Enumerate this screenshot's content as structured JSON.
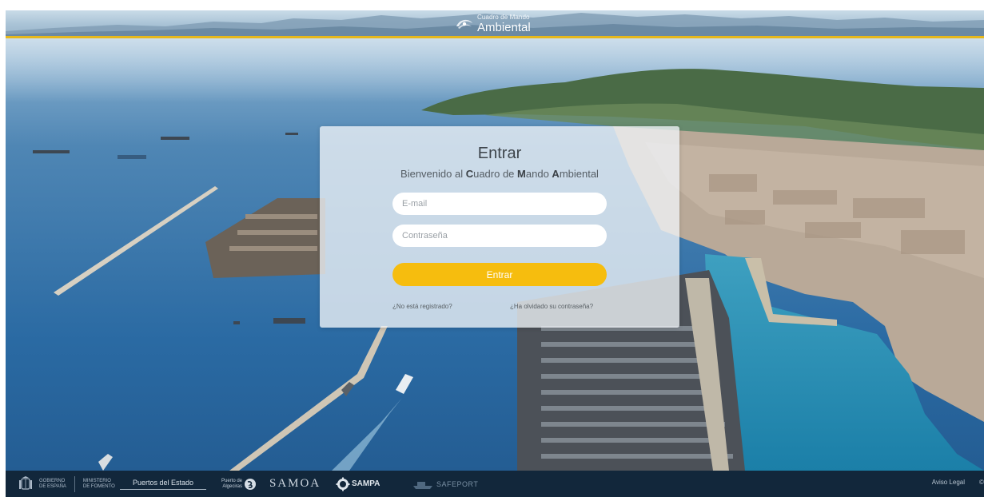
{
  "header": {
    "brand_top": "Cuadro de Mando",
    "brand_bottom": "Ambiental",
    "accent_color": "#e6b81c"
  },
  "login": {
    "title": "Entrar",
    "subtitle_prefix": "Bienvenido al ",
    "subtitle_c_bold": "C",
    "subtitle_c_rest": "uadro de ",
    "subtitle_m_bold": "M",
    "subtitle_m_rest": "ando ",
    "subtitle_a_bold": "A",
    "subtitle_a_rest": "mbiental",
    "email_placeholder": "E-mail",
    "email_value": "",
    "password_placeholder": "Contraseña",
    "password_value": "",
    "submit_label": "Entrar",
    "submit_color": "#f6bd0e",
    "register_link": "¿No está registrado?",
    "forgot_link": "¿Ha olvidado su contraseña?"
  },
  "footer": {
    "gobierno_line1": "GOBIERNO",
    "gobierno_line2": "DE ESPAÑA",
    "ministerio_line1": "MINISTERIO",
    "ministerio_line2": "DE FOMENTO",
    "puertos": "Puertos del Estado",
    "algeciras_line1": "Puerto de",
    "algeciras_line2": "Algeciras",
    "samoa": "SAMOA",
    "sampa": "SAMPA",
    "safeport": "SAFEPORT",
    "aviso_legal": "Aviso Legal",
    "copyright": "©",
    "background_color": "#12273b"
  },
  "icons": {
    "brand_logo": "swirl-logo-icon",
    "crest": "spain-crest-icon",
    "algeciras": "algeciras-logo-icon",
    "sampa": "gear-icon"
  }
}
